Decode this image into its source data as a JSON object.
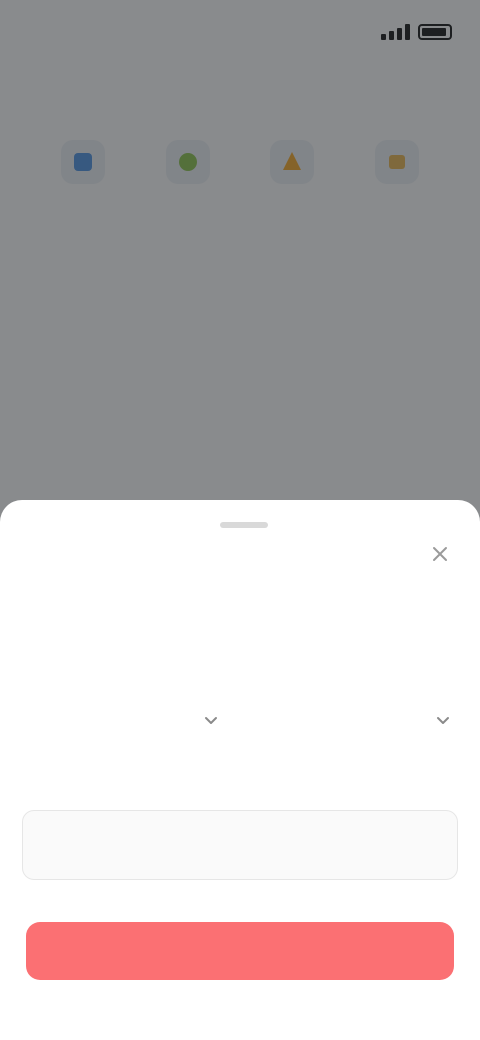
{
  "status_bar": {
    "time": "",
    "signal_icon": "signal-icon",
    "battery_icon": "battery-icon"
  },
  "background": {
    "title": "",
    "services": [
      {
        "label": "",
        "icon": "service-icon",
        "color": "#4a90e2"
      },
      {
        "label": "",
        "icon": "service-icon",
        "color": "#8bc34a"
      },
      {
        "label": "",
        "icon": "service-icon",
        "color": "#f5a623"
      },
      {
        "label": "",
        "icon": "service-icon",
        "color": "#e9b44c"
      },
      {
        "label": "",
        "icon": "service-icon",
        "color": "#5b7be0"
      }
    ],
    "link_text": "",
    "notice_text": ""
  },
  "sheet": {
    "title": "",
    "subtitle": "",
    "close_icon": "close-icon",
    "picker_left_value": "",
    "picker_right_value": "",
    "chevron_icon": "chevron-down-icon",
    "amount_label": "",
    "input_value": "",
    "input_placeholder": "",
    "confirm_label": "",
    "accent_color": "#fb7073"
  }
}
